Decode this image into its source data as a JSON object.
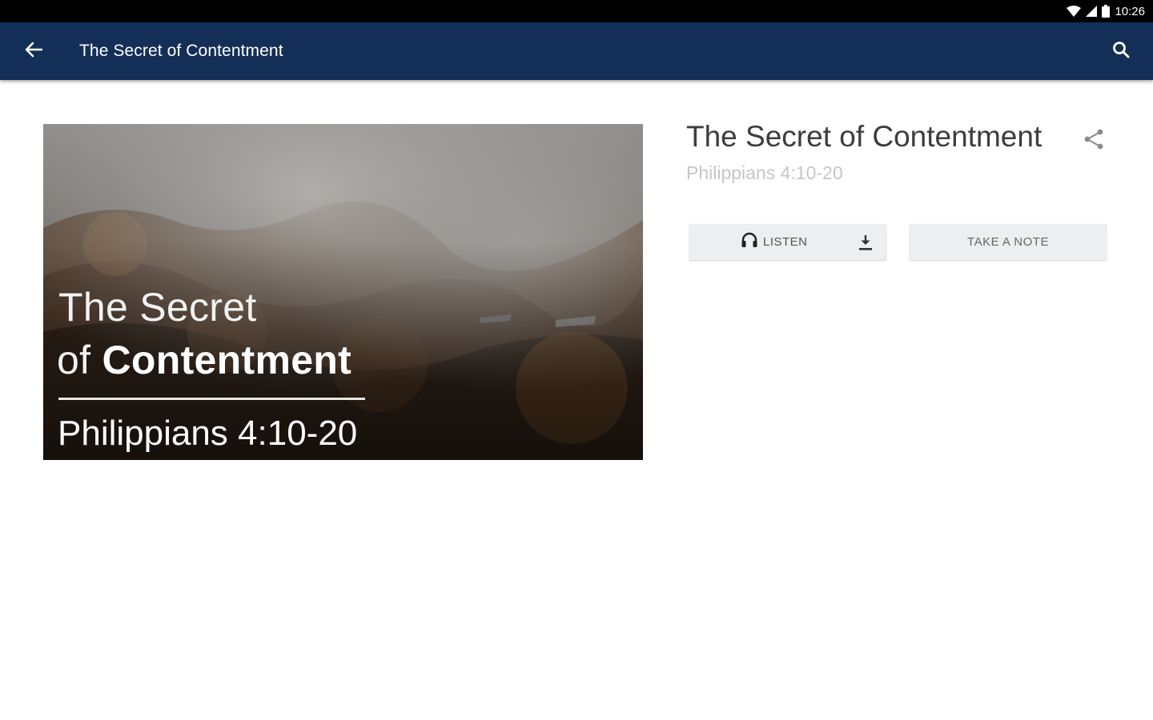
{
  "status_bar": {
    "time": "10:26",
    "icons": [
      "wifi-icon",
      "cellular-signal-icon",
      "battery-icon"
    ]
  },
  "app_bar": {
    "title": "The Secret of Contentment",
    "back_icon": "arrow-back-icon",
    "search_icon": "search-icon",
    "background_color": "#142f57"
  },
  "artwork": {
    "line1": "The Secret",
    "line2_prefix": "of ",
    "line2_bold": "Contentment",
    "reference": "Philippians 4:10-20"
  },
  "detail": {
    "title": "The Secret of Contentment",
    "reference": "Philippians 4:10-20",
    "share_icon": "share-icon"
  },
  "actions": {
    "listen_label": "LISTEN",
    "listen_icon": "headphones-icon",
    "download_icon": "download-icon",
    "note_label": "TAKE A NOTE"
  }
}
